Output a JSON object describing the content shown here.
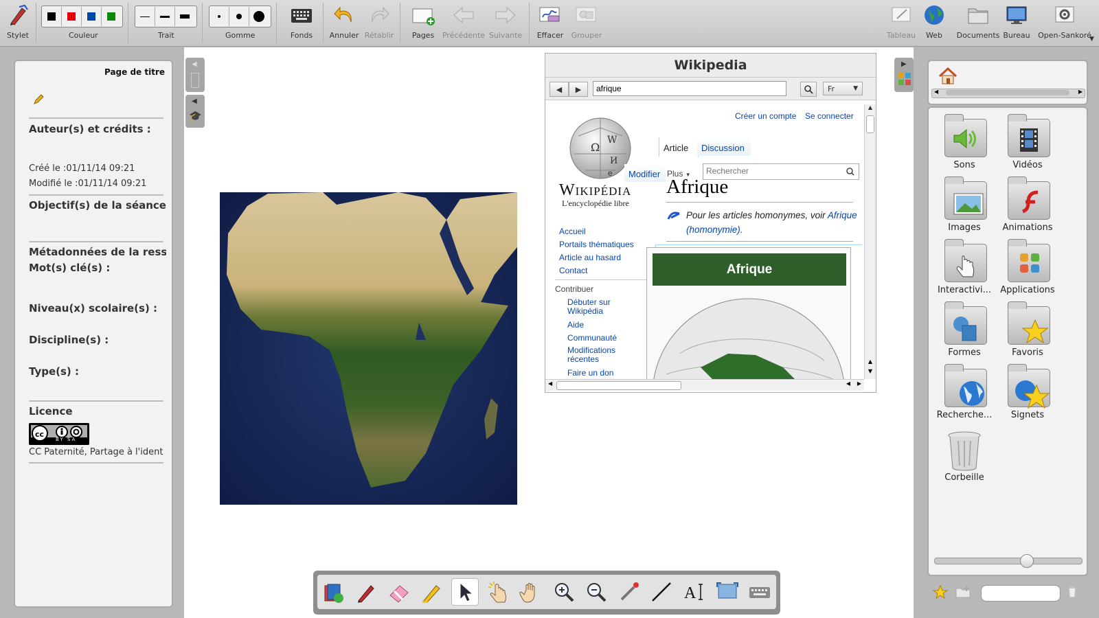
{
  "toolbar": {
    "stylet": "Stylet",
    "couleur": "Couleur",
    "trait": "Trait",
    "gomme": "Gomme",
    "fonds": "Fonds",
    "annuler": "Annuler",
    "retablir": "Rétablir",
    "pages": "Pages",
    "precedente": "Précédente",
    "suivante": "Suivante",
    "effacer": "Effacer",
    "grouper": "Grouper",
    "tableau": "Tableau",
    "web": "Web",
    "documents": "Documents",
    "bureau": "Bureau",
    "open_sankore": "Open-Sankoré",
    "colors": [
      "#000000",
      "#e00000",
      "#0048a8",
      "#0a8a0a"
    ]
  },
  "left_panel": {
    "title": "Page de titre",
    "authors": "Auteur(s) et crédits :",
    "created": "Créé le :01/11/14 09:21",
    "modified": "Modifié le :01/11/14 09:21",
    "objectives": "Objectif(s) de la séance :",
    "metadata": "Métadonnées de la ressou",
    "keywords": "Mot(s) clé(s) :",
    "levels": "Niveau(x) scolaire(s) :",
    "disciplines": "Discipline(s) :",
    "types": "Type(s) :",
    "license": "Licence",
    "license_text": "CC Paternité, Partage à l'ident",
    "cc_badge": "BY SA"
  },
  "wiki": {
    "title": "Wikipedia",
    "search_value": "afrique",
    "lang": "Fr",
    "create_account": "Créer un compte",
    "login": "Se connecter",
    "tab_article": "Article",
    "tab_discussion": "Discussion",
    "edit": "Modifier",
    "more": "Plus",
    "search_placeholder": "Rechercher",
    "logo_name": "Wikipédia",
    "logo_tagline": "L'encyclopédie libre",
    "nav": [
      "Accueil",
      "Portails thématiques",
      "Article au hasard",
      "Contact"
    ],
    "contribute": "Contribuer",
    "contribute_links": [
      "Débuter sur Wikipédia",
      "Aide",
      "Communauté",
      "Modifications récentes",
      "Faire un don"
    ],
    "heading": "Afrique",
    "hatnote_prefix": "Pour les articles homonymes, voir",
    "hatnote_link": "Afrique (homonymie).",
    "infobox_title": "Afrique",
    "partial_tab": "e"
  },
  "library": {
    "items": [
      "Sons",
      "Vidéos",
      "Images",
      "Animations",
      "Interactivi...",
      "Applications",
      "Formes",
      "Favoris",
      "Recherche...",
      "Signets",
      "Corbeille"
    ]
  }
}
